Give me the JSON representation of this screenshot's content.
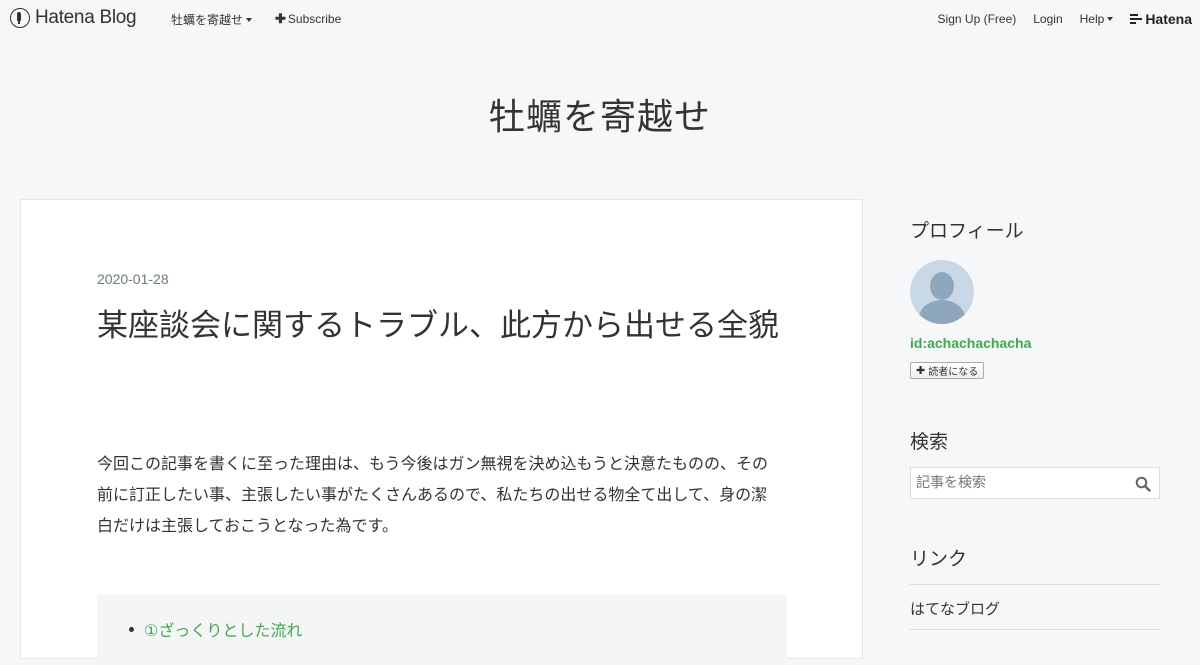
{
  "navbar": {
    "brand": "Hatena Blog",
    "blog_menu": "牡蠣を寄越せ",
    "subscribe": "Subscribe",
    "signup": "Sign Up (Free)",
    "login": "Login",
    "help": "Help",
    "hatena": "Hatena"
  },
  "blog": {
    "title": "牡蠣を寄越せ"
  },
  "entry": {
    "date": "2020-01-28",
    "title": "某座談会に関するトラブル、此方から出せる全貌",
    "body": "今回この記事を書くに至った理由は、もう今後はガン無視を決め込もうと決意たものの、その前に訂正したい事、主張したい事がたくさんあるので、私たちの出せる物全て出して、身の潔白だけは主張しておこうとなった為です。",
    "toc": [
      "①ざっくりとした流れ"
    ]
  },
  "sidebar": {
    "profile_heading": "プロフィール",
    "profile_id": "id:achachachacha",
    "subscribe_button": "読者になる",
    "search_heading": "検索",
    "search_placeholder": "記事を検索",
    "links_heading": "リンク",
    "links": [
      "はてなブログ"
    ]
  },
  "colors": {
    "accent_green": "#3cab4b",
    "page_background": "#f6f7f9",
    "date_color": "#6b7b85"
  },
  "icons": {
    "brand": "hatena-blog-logo-icon",
    "search": "search-icon",
    "avatar": "default-avatar-icon"
  }
}
